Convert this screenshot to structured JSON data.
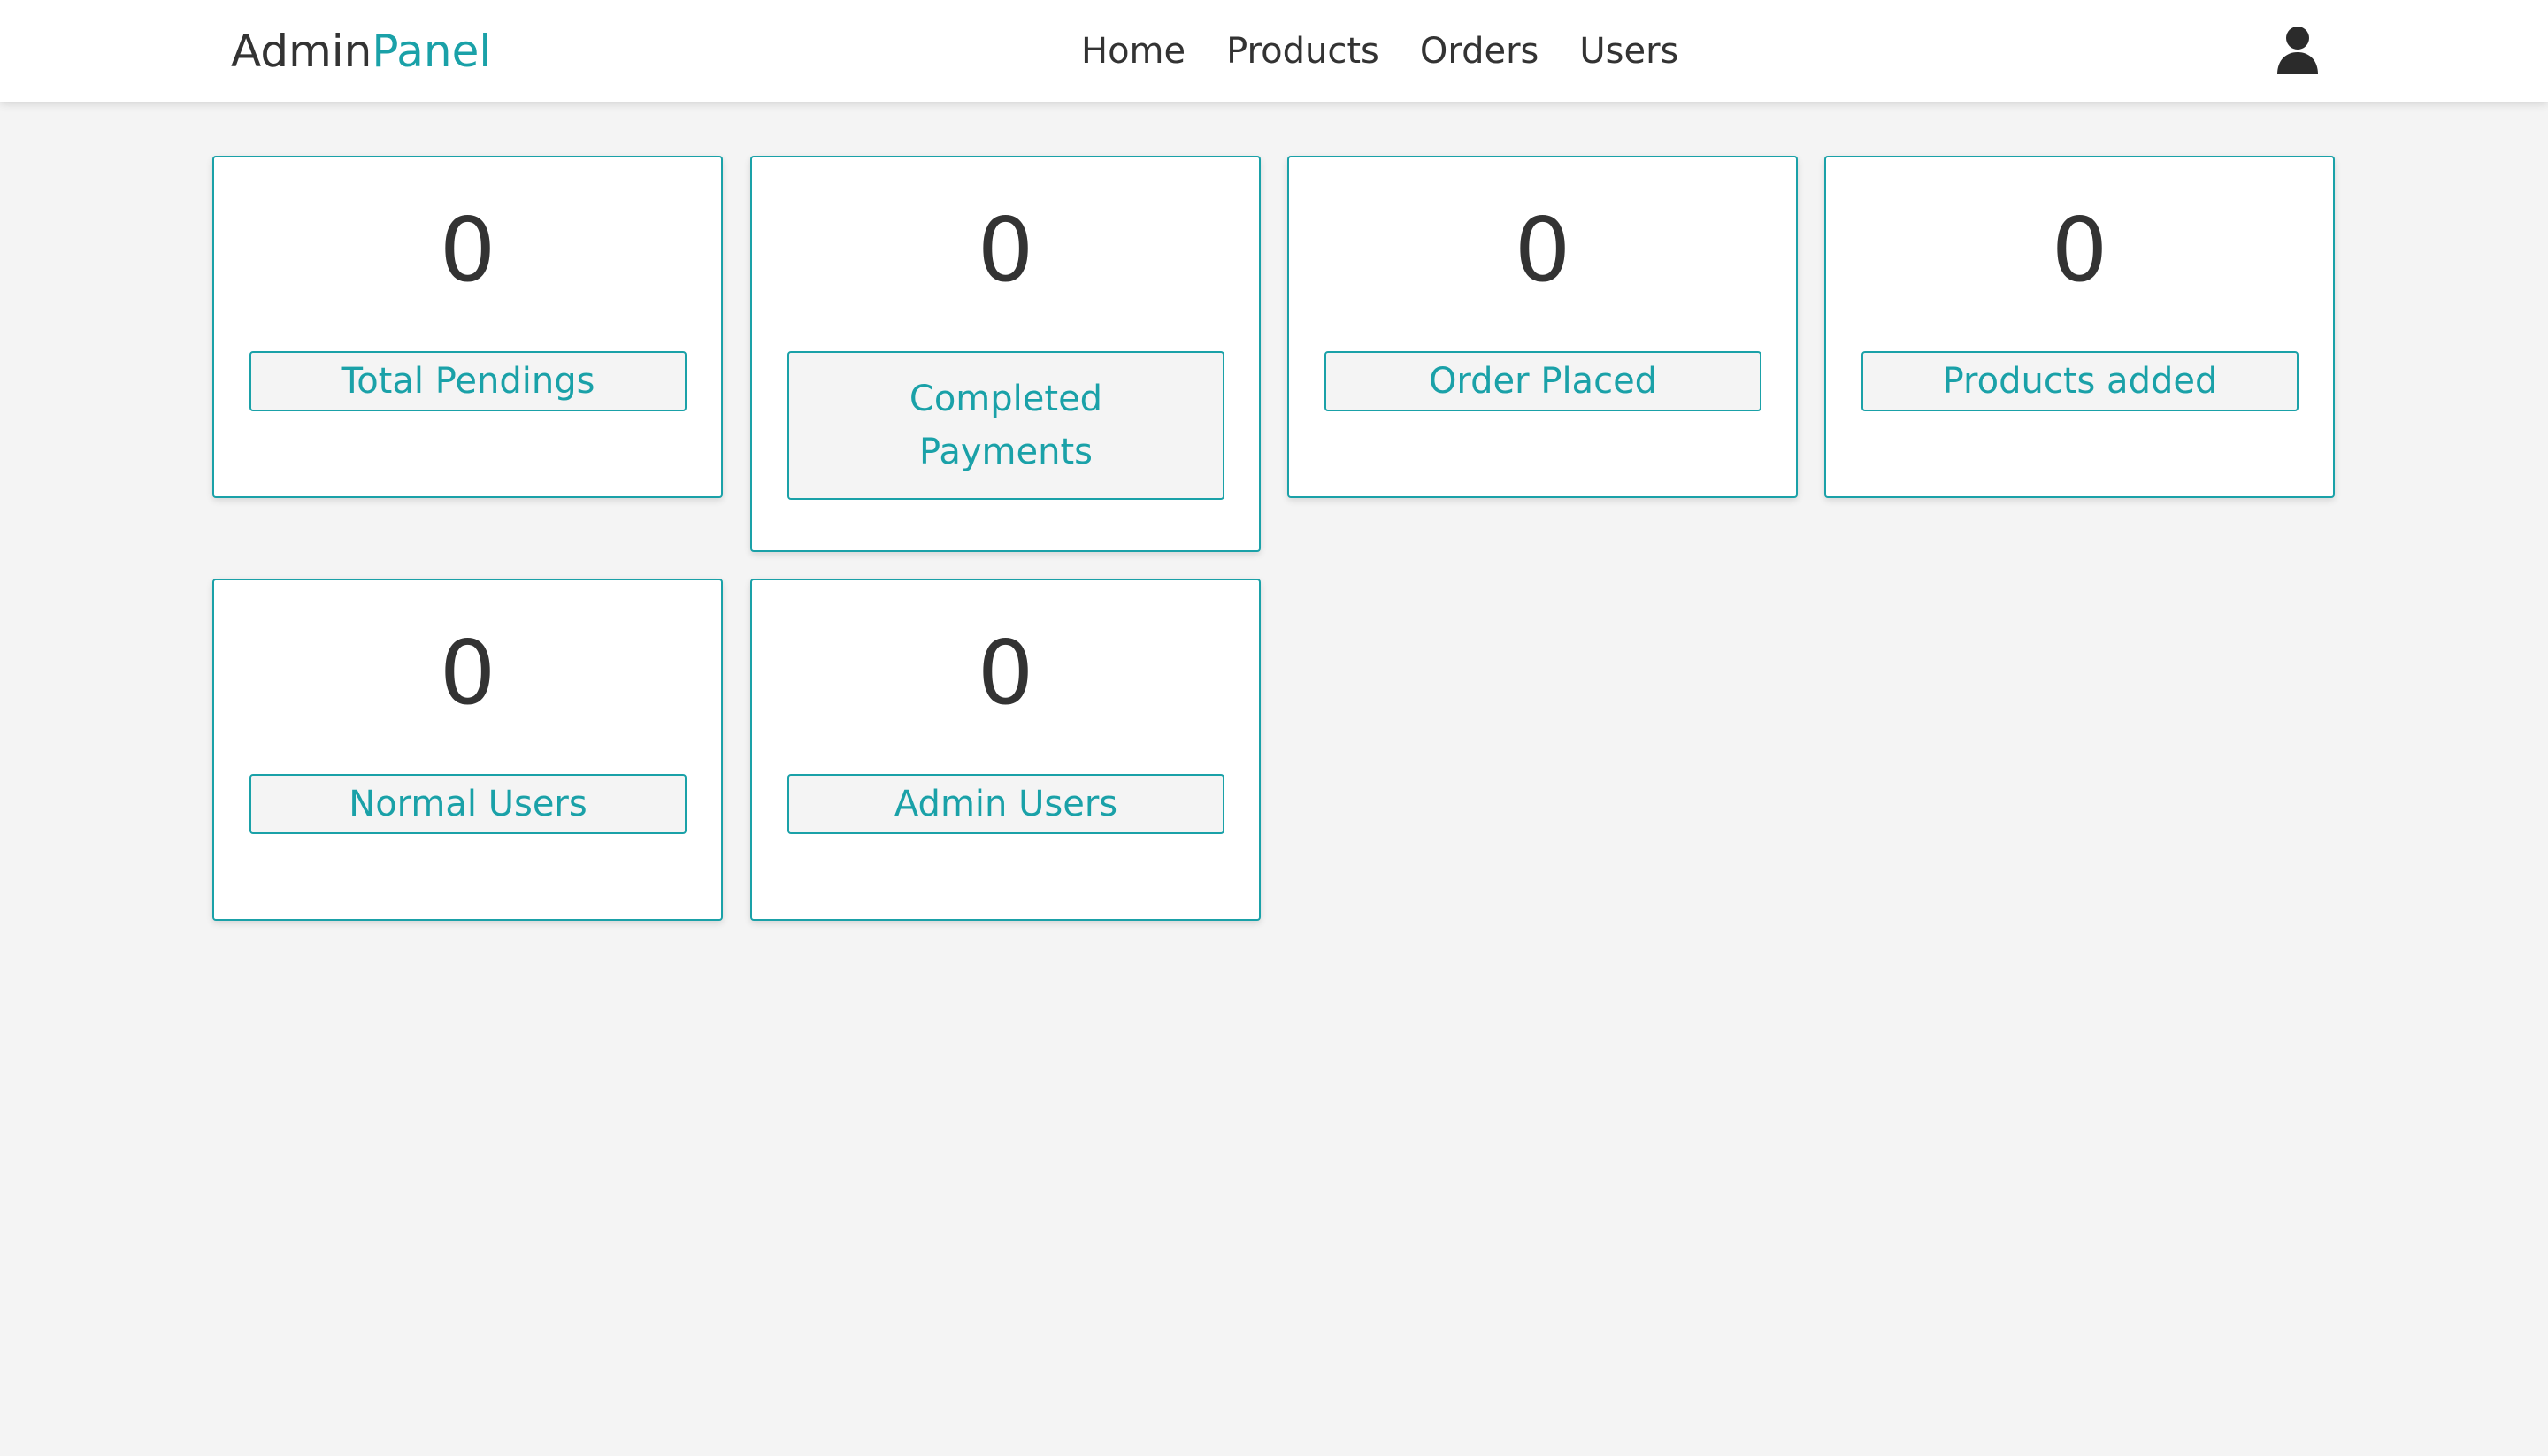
{
  "header": {
    "logo_part1": "Admin",
    "logo_part2": "Panel",
    "nav": [
      "Home",
      "Products",
      "Orders",
      "Users"
    ],
    "user_icon": "user-icon"
  },
  "cards": [
    {
      "value": "0",
      "label": "Total Pendings"
    },
    {
      "value": "0",
      "label": "Completed Payments"
    },
    {
      "value": "0",
      "label": "Order Placed"
    },
    {
      "value": "0",
      "label": "Products added"
    },
    {
      "value": "0",
      "label": "Normal Users"
    },
    {
      "value": "0",
      "label": "Admin Users"
    }
  ],
  "colors": {
    "accent": "#1aa1a8",
    "text": "#333333",
    "background": "#f4f4f4"
  }
}
